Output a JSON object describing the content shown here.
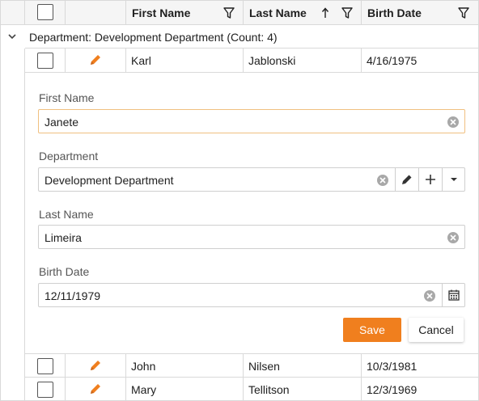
{
  "colors": {
    "accent": "#f07f1e",
    "border": "#d9d9d9",
    "header_bg": "#f5f5f5"
  },
  "columns": {
    "first_name": "First Name",
    "last_name": "Last Name",
    "birth_date": "Birth Date"
  },
  "group": {
    "label": "Department: Development Department (Count: 4)"
  },
  "rows": [
    {
      "first_name": "Karl",
      "last_name": "Jablonski",
      "birth_date": "4/16/1975"
    },
    {
      "first_name": "John",
      "last_name": "Nilsen",
      "birth_date": "10/3/1981"
    },
    {
      "first_name": "Mary",
      "last_name": "Tellitson",
      "birth_date": "12/3/1969"
    }
  ],
  "edit_form": {
    "first_name_label": "First Name",
    "first_name_value": "Janete",
    "department_label": "Department",
    "department_value": "Development Department",
    "last_name_label": "Last Name",
    "last_name_value": "Limeira",
    "birth_date_label": "Birth Date",
    "birth_date_value": "12/11/1979",
    "save_label": "Save",
    "cancel_label": "Cancel"
  },
  "icons": {
    "filter": "filter-icon",
    "sort": "sort-ascending-icon",
    "edit": "pencil-icon",
    "clear": "clear-icon",
    "add": "plus-icon",
    "dropdown": "chevron-down-icon",
    "calendar": "calendar-icon",
    "expand": "chevron-down-icon"
  }
}
